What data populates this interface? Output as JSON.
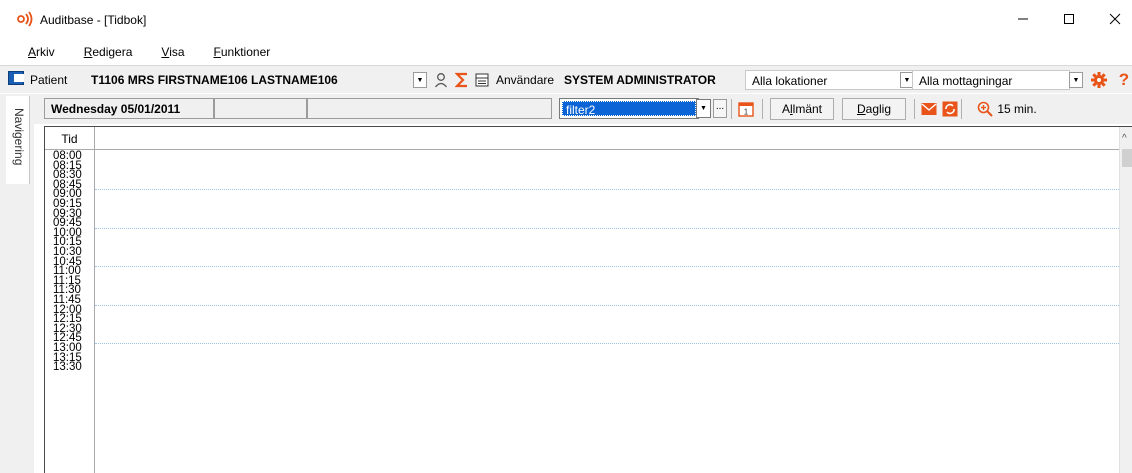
{
  "window": {
    "title": "Auditbase - [Tidbok]"
  },
  "menu": {
    "items": [
      {
        "first": "A",
        "rest": "rkiv"
      },
      {
        "first": "R",
        "rest": "edigera"
      },
      {
        "first": "V",
        "rest": "isa"
      },
      {
        "first": "F",
        "rest": "unktioner"
      }
    ]
  },
  "patientbar": {
    "patient_label": "Patient",
    "patient_value": "T1106 MRS FIRSTNAME106 LASTNAME106",
    "user_label": "Användare",
    "user_value": "SYSTEM ADMINISTRATOR",
    "location": "Alla lokationer",
    "clinic": "Alla mottagningar"
  },
  "navtab": {
    "label": "Navigering"
  },
  "datebar": {
    "date": "Wednesday 05/01/2011",
    "filter": "filter2",
    "dots": "...",
    "general_btn": {
      "pre": "A",
      "u": "l",
      "post": "lmänt"
    },
    "daily_btn": {
      "pre": "",
      "u": "D",
      "post": "aglig"
    },
    "zoom_label": "15 min."
  },
  "grid": {
    "header_time": "Tid",
    "times": [
      "08:00",
      "08:15",
      "08:30",
      "08:45",
      "09:00",
      "09:15",
      "09:30",
      "09:45",
      "10:00",
      "10:15",
      "10:30",
      "10:45",
      "11:00",
      "11:15",
      "11:30",
      "11:45",
      "12:00",
      "12:15",
      "12:30",
      "12:45",
      "13:00",
      "13:15",
      "13:30"
    ]
  },
  "colors": {
    "accent_orange": "#e8541a",
    "selection_blue": "#0a64d6",
    "hour_line": "#9cc3e6"
  }
}
